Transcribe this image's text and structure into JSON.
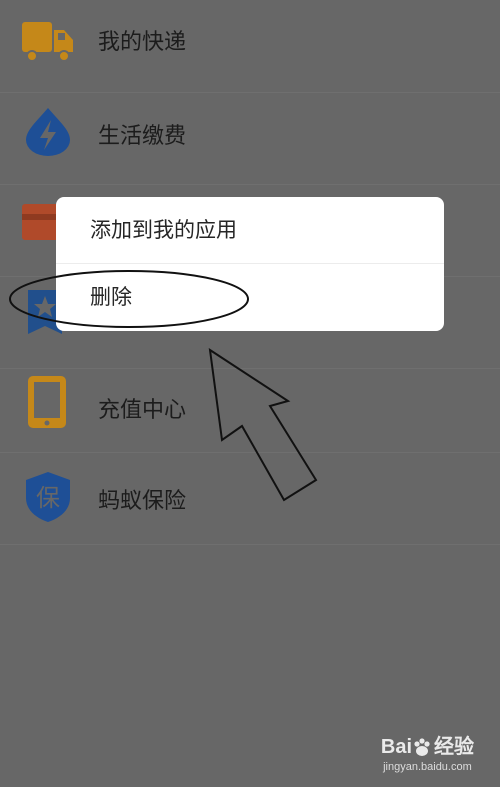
{
  "list_items": [
    {
      "label": "我的快递",
      "icon": "delivery-truck-icon",
      "color": "#c58819"
    },
    {
      "label": "生活缴费",
      "icon": "lightning-drop-icon",
      "color": "#1e4f96"
    },
    {
      "label": "",
      "icon": "card-icon",
      "color": "#b04a2a"
    },
    {
      "label": "",
      "icon": "star-ribbon-icon",
      "color": "#214f8c"
    },
    {
      "label": "充值中心",
      "icon": "tablet-icon",
      "color": "#c58819"
    },
    {
      "label": "蚂蚁保险",
      "icon": "insurance-shield-icon",
      "color": "#1e4f96"
    }
  ],
  "insurance_glyph": "保",
  "context_menu": {
    "add_to_my_apps": "添加到我的应用",
    "delete": "删除"
  },
  "watermark": {
    "brand_left": "Bai",
    "brand_right": "经验",
    "url": "jingyan.baidu.com"
  },
  "colors": {
    "dim_background": "#676767",
    "menu_background": "#ffffff"
  }
}
